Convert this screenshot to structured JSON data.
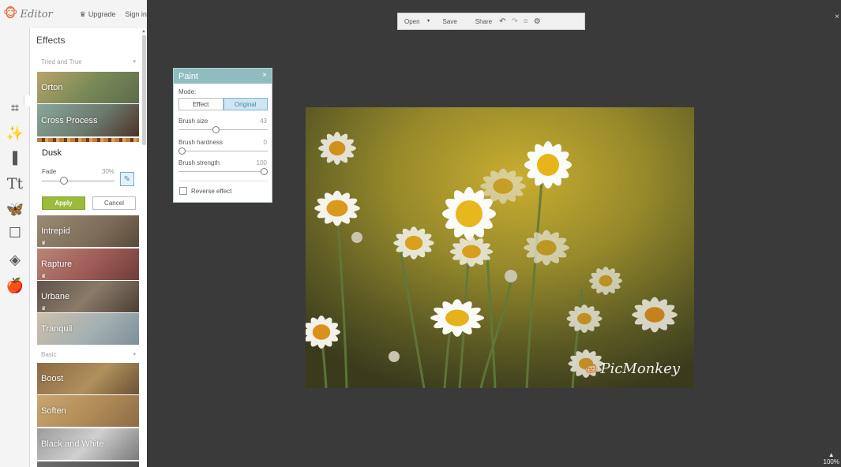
{
  "app": {
    "name": "Editor",
    "upgrade_label": "Upgrade",
    "signin_label": "Sign in"
  },
  "panel": {
    "title": "Effects",
    "sections": {
      "tried_and_true": "Tried and True",
      "basic": "Basic"
    },
    "effects": [
      {
        "label": "Orton"
      },
      {
        "label": "Cross Process"
      },
      {
        "label": "Intrepid"
      },
      {
        "label": "Rapture"
      },
      {
        "label": "Urbane"
      },
      {
        "label": "Tranquil"
      },
      {
        "label": "Boost"
      },
      {
        "label": "Soften"
      },
      {
        "label": "Black and White"
      }
    ],
    "dusk": {
      "name": "Dusk",
      "fade_label": "Fade",
      "fade_value": "30%",
      "fade_level": 0.3,
      "apply_label": "Apply",
      "cancel_label": "Cancel"
    }
  },
  "toolbar": {
    "open_label": "Open",
    "save_label": "Save",
    "share_label": "Share"
  },
  "paint": {
    "title": "Paint",
    "mode_label": "Mode:",
    "mode_options": [
      "Effect",
      "Original"
    ],
    "mode_selected": "Original",
    "brush_size_label": "Brush size",
    "brush_size_value": "43",
    "brush_hardness_label": "Brush hardness",
    "brush_hardness_value": "0",
    "brush_strength_label": "Brush strength",
    "brush_strength_value": "100",
    "reverse_label": "Reverse effect"
  },
  "canvas": {
    "watermark": "PicMonkey",
    "zoom": "100%"
  },
  "colors": {
    "accent": "#3fa6a8",
    "apply": "#9bbb3b",
    "paint_header": "#8fbcbf",
    "canvas_bg": "#3a3a3a"
  }
}
